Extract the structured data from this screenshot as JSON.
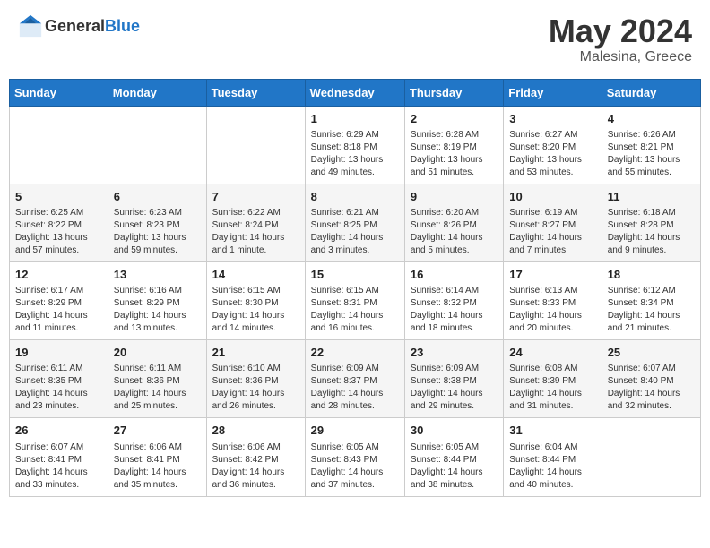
{
  "header": {
    "logo_general": "General",
    "logo_blue": "Blue",
    "month": "May 2024",
    "location": "Malesina, Greece"
  },
  "weekdays": [
    "Sunday",
    "Monday",
    "Tuesday",
    "Wednesday",
    "Thursday",
    "Friday",
    "Saturday"
  ],
  "weeks": [
    [
      {
        "day": "",
        "info": ""
      },
      {
        "day": "",
        "info": ""
      },
      {
        "day": "",
        "info": ""
      },
      {
        "day": "1",
        "info": "Sunrise: 6:29 AM\nSunset: 8:18 PM\nDaylight: 13 hours\nand 49 minutes."
      },
      {
        "day": "2",
        "info": "Sunrise: 6:28 AM\nSunset: 8:19 PM\nDaylight: 13 hours\nand 51 minutes."
      },
      {
        "day": "3",
        "info": "Sunrise: 6:27 AM\nSunset: 8:20 PM\nDaylight: 13 hours\nand 53 minutes."
      },
      {
        "day": "4",
        "info": "Sunrise: 6:26 AM\nSunset: 8:21 PM\nDaylight: 13 hours\nand 55 minutes."
      }
    ],
    [
      {
        "day": "5",
        "info": "Sunrise: 6:25 AM\nSunset: 8:22 PM\nDaylight: 13 hours\nand 57 minutes."
      },
      {
        "day": "6",
        "info": "Sunrise: 6:23 AM\nSunset: 8:23 PM\nDaylight: 13 hours\nand 59 minutes."
      },
      {
        "day": "7",
        "info": "Sunrise: 6:22 AM\nSunset: 8:24 PM\nDaylight: 14 hours\nand 1 minute."
      },
      {
        "day": "8",
        "info": "Sunrise: 6:21 AM\nSunset: 8:25 PM\nDaylight: 14 hours\nand 3 minutes."
      },
      {
        "day": "9",
        "info": "Sunrise: 6:20 AM\nSunset: 8:26 PM\nDaylight: 14 hours\nand 5 minutes."
      },
      {
        "day": "10",
        "info": "Sunrise: 6:19 AM\nSunset: 8:27 PM\nDaylight: 14 hours\nand 7 minutes."
      },
      {
        "day": "11",
        "info": "Sunrise: 6:18 AM\nSunset: 8:28 PM\nDaylight: 14 hours\nand 9 minutes."
      }
    ],
    [
      {
        "day": "12",
        "info": "Sunrise: 6:17 AM\nSunset: 8:29 PM\nDaylight: 14 hours\nand 11 minutes."
      },
      {
        "day": "13",
        "info": "Sunrise: 6:16 AM\nSunset: 8:29 PM\nDaylight: 14 hours\nand 13 minutes."
      },
      {
        "day": "14",
        "info": "Sunrise: 6:15 AM\nSunset: 8:30 PM\nDaylight: 14 hours\nand 14 minutes."
      },
      {
        "day": "15",
        "info": "Sunrise: 6:15 AM\nSunset: 8:31 PM\nDaylight: 14 hours\nand 16 minutes."
      },
      {
        "day": "16",
        "info": "Sunrise: 6:14 AM\nSunset: 8:32 PM\nDaylight: 14 hours\nand 18 minutes."
      },
      {
        "day": "17",
        "info": "Sunrise: 6:13 AM\nSunset: 8:33 PM\nDaylight: 14 hours\nand 20 minutes."
      },
      {
        "day": "18",
        "info": "Sunrise: 6:12 AM\nSunset: 8:34 PM\nDaylight: 14 hours\nand 21 minutes."
      }
    ],
    [
      {
        "day": "19",
        "info": "Sunrise: 6:11 AM\nSunset: 8:35 PM\nDaylight: 14 hours\nand 23 minutes."
      },
      {
        "day": "20",
        "info": "Sunrise: 6:11 AM\nSunset: 8:36 PM\nDaylight: 14 hours\nand 25 minutes."
      },
      {
        "day": "21",
        "info": "Sunrise: 6:10 AM\nSunset: 8:36 PM\nDaylight: 14 hours\nand 26 minutes."
      },
      {
        "day": "22",
        "info": "Sunrise: 6:09 AM\nSunset: 8:37 PM\nDaylight: 14 hours\nand 28 minutes."
      },
      {
        "day": "23",
        "info": "Sunrise: 6:09 AM\nSunset: 8:38 PM\nDaylight: 14 hours\nand 29 minutes."
      },
      {
        "day": "24",
        "info": "Sunrise: 6:08 AM\nSunset: 8:39 PM\nDaylight: 14 hours\nand 31 minutes."
      },
      {
        "day": "25",
        "info": "Sunrise: 6:07 AM\nSunset: 8:40 PM\nDaylight: 14 hours\nand 32 minutes."
      }
    ],
    [
      {
        "day": "26",
        "info": "Sunrise: 6:07 AM\nSunset: 8:41 PM\nDaylight: 14 hours\nand 33 minutes."
      },
      {
        "day": "27",
        "info": "Sunrise: 6:06 AM\nSunset: 8:41 PM\nDaylight: 14 hours\nand 35 minutes."
      },
      {
        "day": "28",
        "info": "Sunrise: 6:06 AM\nSunset: 8:42 PM\nDaylight: 14 hours\nand 36 minutes."
      },
      {
        "day": "29",
        "info": "Sunrise: 6:05 AM\nSunset: 8:43 PM\nDaylight: 14 hours\nand 37 minutes."
      },
      {
        "day": "30",
        "info": "Sunrise: 6:05 AM\nSunset: 8:44 PM\nDaylight: 14 hours\nand 38 minutes."
      },
      {
        "day": "31",
        "info": "Sunrise: 6:04 AM\nSunset: 8:44 PM\nDaylight: 14 hours\nand 40 minutes."
      },
      {
        "day": "",
        "info": ""
      }
    ]
  ]
}
